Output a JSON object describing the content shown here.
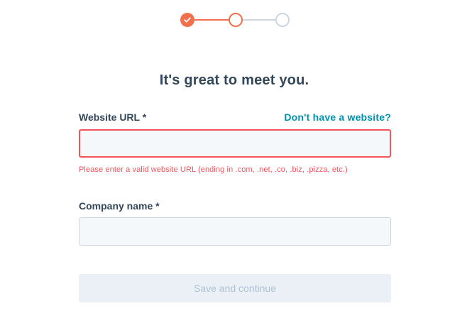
{
  "stepper": {
    "current_step": 2,
    "total_steps": 3,
    "steps": [
      {
        "state": "complete",
        "icon": "check-icon"
      },
      {
        "state": "current"
      },
      {
        "state": "upcoming"
      }
    ],
    "colors": {
      "active": "#f2714d",
      "inactive": "#cbd6e2"
    }
  },
  "form": {
    "title": "It's great to meet you.",
    "website": {
      "label": "Website URL *",
      "link": "Don't have a website?",
      "value": "",
      "error": "Please enter a valid website URL (ending in .com, .net, .co, .biz, .pizza, etc.)"
    },
    "company": {
      "label": "Company name *",
      "value": ""
    },
    "submit_label": "Save and continue",
    "submit_disabled": true
  },
  "colors": {
    "heading": "#33475b",
    "link": "#0091ae",
    "error": "#f2545b",
    "input_bg": "#f5f8fa",
    "button_disabled_bg": "#eaf0f6",
    "button_disabled_text": "#b0c1d4"
  }
}
